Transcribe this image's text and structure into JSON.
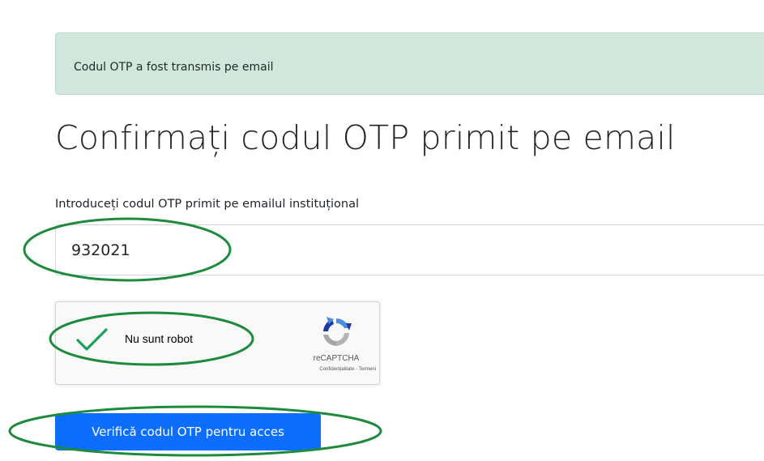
{
  "alert": {
    "message": "Codul OTP a fost transmis pe email",
    "color": "#d1e7dd"
  },
  "page": {
    "title": "Confirmați codul OTP primit pe email"
  },
  "otp_field": {
    "label": "Introduceți codul OTP primit pe emailul instituțional",
    "value": "932021"
  },
  "recaptcha": {
    "checked": true,
    "label": "Nu sunt robot",
    "brand": "reCAPTCHA",
    "privacy_link": "Confidențialitate",
    "separator": " - ",
    "terms_link": "Termeni",
    "icons": [
      "check-icon",
      "recaptcha-logo-icon"
    ]
  },
  "submit": {
    "label": "Verifică codul OTP pentru acces",
    "color": "#0d6efd"
  },
  "annotations": {
    "color": "#1e8a3c",
    "shape": "ellipse"
  }
}
